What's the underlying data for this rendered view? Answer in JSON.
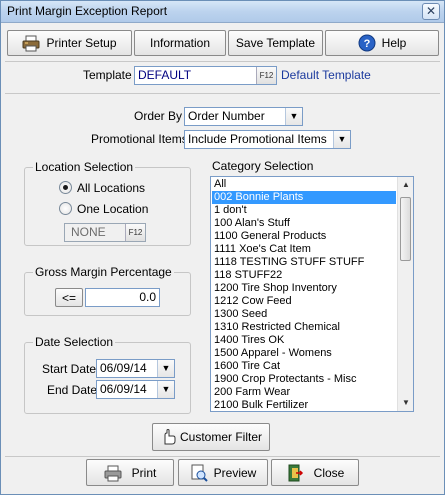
{
  "window": {
    "title": "Print Margin Exception Report",
    "close_glyph": "✕"
  },
  "toolbar": {
    "printer_setup": "Printer Setup",
    "information": "Information",
    "save_template": "Save Template",
    "help": "Help"
  },
  "template": {
    "label": "Template",
    "value": "DEFAULT",
    "lookup_key": "F12",
    "description": "Default Template"
  },
  "order_by": {
    "label": "Order By",
    "value": "Order Number"
  },
  "promotional": {
    "label": "Promotional Items",
    "value": "Include Promotional Items"
  },
  "location": {
    "title": "Location Selection",
    "all_label": "All Locations",
    "one_label": "One Location",
    "selected": "all",
    "value": "NONE",
    "lookup_key": "F12"
  },
  "gross_margin": {
    "title": "Gross Margin Percentage",
    "operator": "<=",
    "value": "0.0"
  },
  "date": {
    "title": "Date Selection",
    "start_label": "Start Date",
    "start_value": "06/09/14",
    "end_label": "End Date",
    "end_value": "06/09/14"
  },
  "category": {
    "title": "Category Selection",
    "selected_index": 1,
    "items": [
      "All",
      "002 Bonnie Plants",
      "1 don't",
      "100 Alan's Stuff",
      "1100 General Products",
      "1111 Xoe's Cat Item",
      "1118 TESTING STUFF STUFF",
      "118 STUFF22",
      "1200 Tire Shop Inventory",
      "1212 Cow Feed",
      "1300 Seed",
      "1310 Restricted Chemical",
      "1400 Tires OK",
      "1500 Apparel - Womens",
      "1600 Tire Cat",
      "1900 Crop Protectants - Misc",
      "200 Farm Wear",
      "2100 Bulk Fertilizer"
    ]
  },
  "customer_filter": "Customer Filter",
  "bottom": {
    "print": "Print",
    "preview": "Preview",
    "close": "Close"
  },
  "colors": {
    "selection": "#3399ff",
    "link_text": "#1c3a9e",
    "field_text_blue": "#000080"
  }
}
